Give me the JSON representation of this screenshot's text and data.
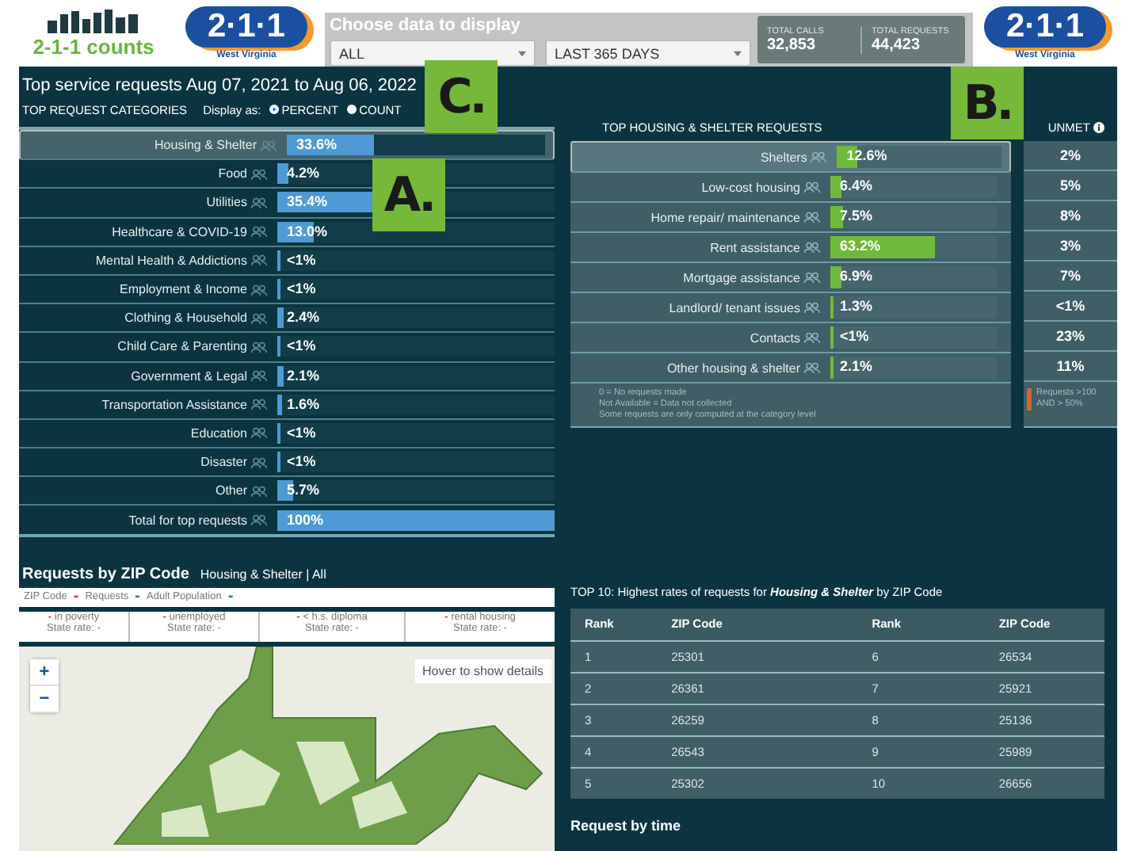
{
  "header": {
    "brand": "2-1-1 counts",
    "logo_left": {
      "number": "2·1·1",
      "region": "West Virginia"
    },
    "filter_title": "Choose data to display",
    "filters": [
      {
        "value": "ALL"
      },
      {
        "value": "LAST 365 DAYS"
      }
    ],
    "stats": [
      {
        "label": "TOTAL CALLS",
        "value": "32,853"
      },
      {
        "label": "TOTAL REQUESTS",
        "value": "44,423"
      }
    ],
    "logo_right": {
      "number": "2·1·1",
      "region": "West Virginia"
    }
  },
  "title": "Top service requests Aug 07, 2021 to Aug 06, 2022",
  "categories": {
    "heading": "TOP REQUEST CATEGORIES",
    "display_label": "Display as:",
    "display_options": [
      {
        "label": "PERCENT",
        "selected": true
      },
      {
        "label": "COUNT",
        "selected": false
      }
    ],
    "rows": [
      {
        "label": "Housing & Shelter",
        "value": "33.6%",
        "level": 0.336,
        "selected": true
      },
      {
        "label": "Food",
        "value": "4.2%",
        "level": 0.042,
        "selected": false
      },
      {
        "label": "Utilities",
        "value": "35.4%",
        "level": 0.354,
        "selected": false
      },
      {
        "label": "Healthcare & COVID-19",
        "value": "13.0%",
        "level": 0.13,
        "selected": false
      },
      {
        "label": "Mental Health & Addictions",
        "value": "<1%",
        "level": 0.005,
        "selected": false
      },
      {
        "label": "Employment & Income",
        "value": "<1%",
        "level": 0.005,
        "selected": false
      },
      {
        "label": "Clothing & Household",
        "value": "2.4%",
        "level": 0.024,
        "selected": false
      },
      {
        "label": "Child Care & Parenting",
        "value": "<1%",
        "level": 0.005,
        "selected": false
      },
      {
        "label": "Government & Legal",
        "value": "2.1%",
        "level": 0.021,
        "selected": false
      },
      {
        "label": "Transportation Assistance",
        "value": "1.6%",
        "level": 0.016,
        "selected": false
      },
      {
        "label": "Education",
        "value": "<1%",
        "level": 0.005,
        "selected": false
      },
      {
        "label": "Disaster",
        "value": "<1%",
        "level": 0.005,
        "selected": false
      },
      {
        "label": "Other",
        "value": "5.7%",
        "level": 0.057,
        "selected": false
      },
      {
        "label": "Total for top requests",
        "value": "100%",
        "level": 1,
        "selected": false
      }
    ]
  },
  "housing": {
    "heading": "TOP HOUSING & SHELTER REQUESTS",
    "unmet_heading": "UNMET",
    "rows": [
      {
        "label": "Shelters",
        "value": "12.6%",
        "level": 0.126,
        "unmet": "2%",
        "selected": true
      },
      {
        "label": "Low-cost housing",
        "value": "6.4%",
        "level": 0.064,
        "unmet": "5%",
        "selected": false
      },
      {
        "label": "Home repair/ maintenance",
        "value": "7.5%",
        "level": 0.075,
        "unmet": "8%",
        "selected": false
      },
      {
        "label": "Rent assistance",
        "value": "63.2%",
        "level": 0.632,
        "unmet": "3%",
        "selected": false
      },
      {
        "label": "Mortgage assistance",
        "value": "6.9%",
        "level": 0.069,
        "unmet": "7%",
        "selected": false
      },
      {
        "label": "Landlord/ tenant issues",
        "value": "1.3%",
        "level": 0.013,
        "unmet": "<1%",
        "selected": false
      },
      {
        "label": "Contacts",
        "value": "<1%",
        "level": 0.005,
        "unmet": "23%",
        "selected": false
      },
      {
        "label": "Other housing & shelter",
        "value": "2.1%",
        "level": 0.021,
        "unmet": "11%",
        "selected": false
      }
    ],
    "notes": [
      "0 = No requests made",
      "Not Available = Data not collected",
      "Some requests are only computed at the category level"
    ],
    "legend": [
      "Requests >100",
      "AND > 50%"
    ]
  },
  "zip_map": {
    "title": "Requests by ZIP Code",
    "subtitle": "Housing & Shelter | All",
    "legend": [
      {
        "label": "ZIP Code",
        "value": "-",
        "color": "#e0245e"
      },
      {
        "label": "Requests",
        "value": "-",
        "color": "#1f6fd0"
      },
      {
        "label": "Adult Population",
        "value": "-",
        "color": "#1f6fd0"
      }
    ],
    "rates": [
      {
        "label": "in poverty",
        "value": "-",
        "state_rate": "State rate: -"
      },
      {
        "label": "unemployed",
        "value": "-",
        "state_rate": "State rate: -"
      },
      {
        "label": "< h.s. diploma",
        "value": "-",
        "state_rate": "State rate: -"
      },
      {
        "label": "rental housing",
        "value": "-",
        "state_rate": "State rate: -"
      }
    ],
    "zoom_in": "+",
    "zoom_out": "−",
    "hover_hint": "Hover to show details"
  },
  "top10": {
    "title": "TOP 10: Highest rates of requests for **Housing & Shelter** by ZIP Code",
    "columns": [
      "Rank",
      "ZIP Code",
      "Rank",
      "ZIP Code"
    ],
    "rows": [
      [
        "1",
        "25301",
        "6",
        "26534"
      ],
      [
        "2",
        "26361",
        "7",
        "25921"
      ],
      [
        "3",
        "26259",
        "8",
        "25136"
      ],
      [
        "4",
        "26543",
        "9",
        "25989"
      ],
      [
        "5",
        "25302",
        "10",
        "26656"
      ]
    ]
  },
  "request_by_time": "Request by time",
  "callouts": [
    {
      "label": "C."
    },
    {
      "label": "A."
    },
    {
      "label": "B."
    }
  ]
}
